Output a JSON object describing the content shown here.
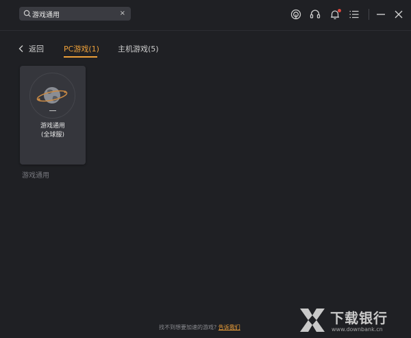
{
  "search": {
    "value": "游戏通用",
    "clear_label": "×",
    "icon": "search-icon"
  },
  "toolbar": {
    "icons": [
      "speed-icon",
      "headset-icon",
      "bell-icon",
      "menu-icon",
      "minimize-icon",
      "close-icon"
    ],
    "notification_dot_color": "#e0463c"
  },
  "nav": {
    "back_label": "返回",
    "tabs": [
      {
        "label": "PC游戏(1)",
        "active": true
      },
      {
        "label": "主机游戏(5)",
        "active": false
      }
    ],
    "active_color": "#f0a23a"
  },
  "games": [
    {
      "title": "游戏通用",
      "subtitle": "(全球服)",
      "caption": "游戏通用",
      "icon": "globe-icon"
    }
  ],
  "footer": {
    "prompt": "找不到想要加速的游戏?",
    "link_label": "告诉我们"
  },
  "watermark": {
    "name": "下载银行",
    "url": "www.downbank.cn"
  },
  "colors": {
    "background": "#1f2024",
    "card": "#35363c",
    "accent": "#f0a23a"
  }
}
